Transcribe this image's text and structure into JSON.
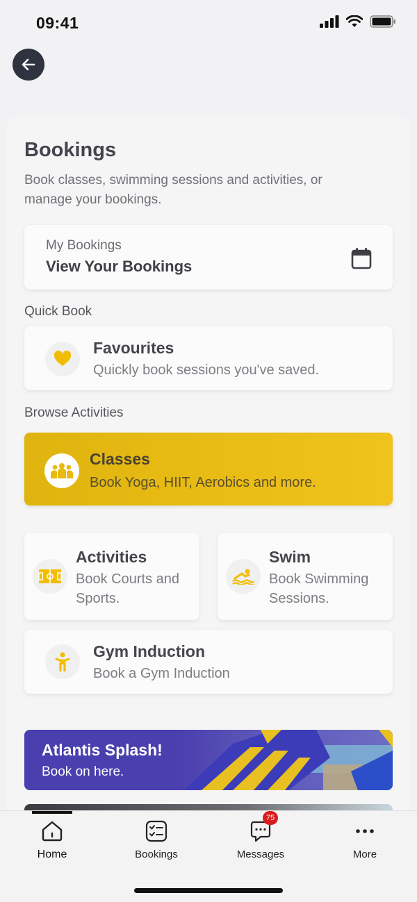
{
  "status": {
    "time": "09:41"
  },
  "colors": {
    "accent": "#f0c21c",
    "icon_yellow": "#f2bd00",
    "back_button": "#2f3340",
    "promo": "#4a3fae",
    "badge": "#d91c1c"
  },
  "header": {
    "title": "Bookings",
    "subtitle": "Book classes, swimming sessions and activities, or manage your bookings."
  },
  "my_bookings": {
    "label": "My Bookings",
    "title": "View Your Bookings",
    "icon": "calendar-icon"
  },
  "quick_book": {
    "section_label": "Quick Book",
    "favourites": {
      "title": "Favourites",
      "subtitle": "Quickly book sessions you've saved.",
      "icon": "heart-icon"
    }
  },
  "browse": {
    "section_label": "Browse Activities",
    "classes": {
      "title": "Classes",
      "subtitle": "Book Yoga, HIIT, Aerobics and more.",
      "icon": "group-icon"
    },
    "activities": {
      "title": "Activities",
      "subtitle": "Book Courts and Sports.",
      "icon": "court-icon"
    },
    "swim": {
      "title": "Swim",
      "subtitle": "Book Swimming Sessions.",
      "icon": "swim-icon"
    },
    "gym_induction": {
      "title": "Gym Induction",
      "subtitle": "Book a Gym Induction",
      "icon": "person-icon"
    }
  },
  "promo": {
    "title": "Atlantis Splash!",
    "subtitle": "Book on here."
  },
  "tabbar": {
    "tabs": [
      {
        "label": "Home",
        "icon": "home-icon",
        "active": true
      },
      {
        "label": "Bookings",
        "icon": "checklist-icon"
      },
      {
        "label": "Messages",
        "icon": "chat-icon",
        "badge": "75"
      },
      {
        "label": "More",
        "icon": "more-icon"
      }
    ]
  }
}
